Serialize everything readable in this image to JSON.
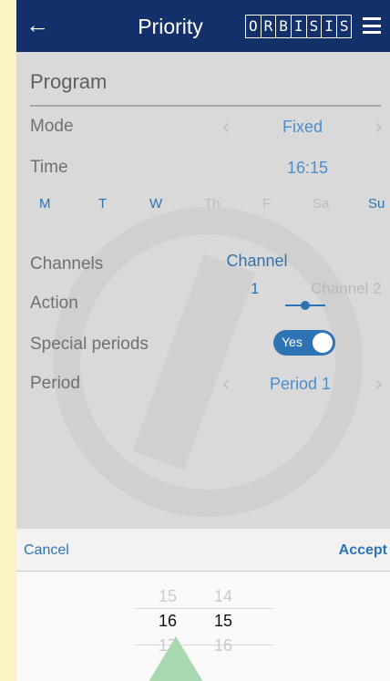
{
  "header": {
    "title": "Priority",
    "logo_letters": [
      "O",
      "R",
      "B",
      "I",
      "S",
      "I",
      "S"
    ]
  },
  "program": {
    "label": "Program"
  },
  "mode": {
    "label": "Mode",
    "value": "Fixed"
  },
  "time": {
    "label": "Time",
    "value": "16:15"
  },
  "days": [
    {
      "label": "M",
      "active": true
    },
    {
      "label": "T",
      "active": true
    },
    {
      "label": "W",
      "active": true
    },
    {
      "label": "Th",
      "active": false
    },
    {
      "label": "F",
      "active": false
    },
    {
      "label": "Sa",
      "active": false
    },
    {
      "label": "Su",
      "active": true
    }
  ],
  "channels": {
    "label": "Channels",
    "active_label": "Channel",
    "active_number": "1",
    "other": "Channel 2"
  },
  "action": {
    "label": "Action"
  },
  "special": {
    "label": "Special periods",
    "toggle": "Yes"
  },
  "period": {
    "label": "Period",
    "value": "Period 1"
  },
  "picker": {
    "cancel": "Cancel",
    "accept": "Accept",
    "hours": [
      "15",
      "16",
      "17"
    ],
    "minutes": [
      "14",
      "15",
      "16"
    ]
  },
  "colors": {
    "header": "#13306b",
    "accent": "#2e74b5",
    "background": "#fcf3c3"
  }
}
